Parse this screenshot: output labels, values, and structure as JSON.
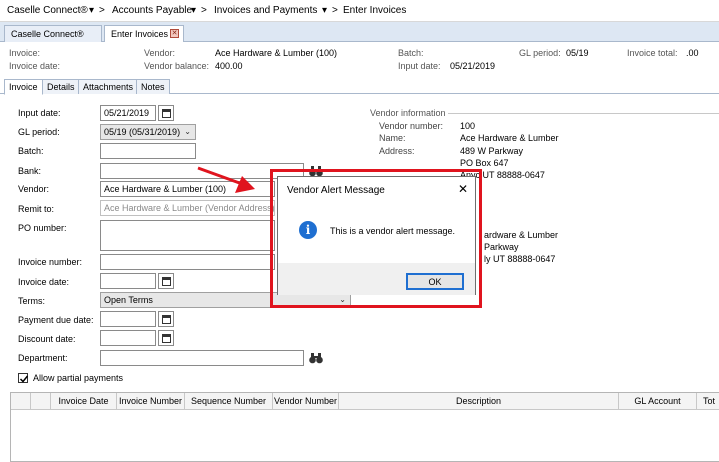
{
  "breadcrumb": {
    "items": [
      "Caselle Connect®",
      "Accounts Payable",
      "Invoices and Payments",
      "Enter Invoices"
    ],
    "separator": "> "
  },
  "tabs": [
    {
      "label": "Caselle Connect®"
    },
    {
      "label": "Enter Invoices"
    }
  ],
  "summary": {
    "invoice_label": "Invoice:",
    "invoice_date_label": "Invoice date:",
    "vendor_label": "Vendor:",
    "vendor_value": "Ace Hardware & Lumber (100)",
    "vendor_balance_label": "Vendor balance:",
    "vendor_balance_value": "400.00",
    "batch_label": "Batch:",
    "input_date_label": "Input date:",
    "input_date_value": "05/21/2019",
    "gl_period_label": "GL period:",
    "gl_period_value": "05/19",
    "invoice_total_label": "Invoice total:",
    "invoice_total_value": ".00"
  },
  "subtabs": [
    "Invoice",
    "Details",
    "Attachments",
    "Notes"
  ],
  "form": {
    "input_date_label": "Input date:",
    "input_date_value": "05/21/2019",
    "gl_period_label": "GL period:",
    "gl_period_value": "05/19 (05/31/2019)",
    "batch_label": "Batch:",
    "bank_label": "Bank:",
    "vendor_label": "Vendor:",
    "vendor_value": "Ace Hardware & Lumber (100)",
    "remit_to_label": "Remit to:",
    "remit_to_value": "Ace Hardware & Lumber (Vendor Address)",
    "po_number_label": "PO number:",
    "invoice_number_label": "Invoice number:",
    "invoice_date_label": "Invoice date:",
    "terms_label": "Terms:",
    "terms_value": "Open Terms",
    "payment_due_date_label": "Payment due date:",
    "discount_date_label": "Discount date:",
    "department_label": "Department:",
    "allow_partial_label": "Allow partial payments"
  },
  "vendor_info": {
    "heading": "Vendor information",
    "vendor_number_label": "Vendor number:",
    "vendor_number_value": "100",
    "name_label": "Name:",
    "name_value": "Ace Hardware & Lumber",
    "address_label": "Address:",
    "address_line1": "489 W Parkway",
    "address_line2": "PO Box 647",
    "address_line3": "Anyc  UT  88888-0647",
    "remit_name_partial": "ardware & Lumber",
    "remit_addr_partial": "Parkway",
    "remit_city_partial": "ly  UT  88888-0647"
  },
  "grid": {
    "columns": [
      "Invoice Date",
      "Invoice Number",
      "Sequence Number",
      "Vendor Number",
      "Description",
      "GL Account",
      "Tot"
    ]
  },
  "dialog": {
    "title": "Vendor Alert Message",
    "message": "This is a vendor alert message.",
    "ok_label": "OK",
    "close_glyph": "✕",
    "icon_glyph": "i"
  },
  "colors": {
    "highlight": "#e0141e",
    "info_blue": "#1f6fd1",
    "tab_strip": "#dde7f3"
  }
}
